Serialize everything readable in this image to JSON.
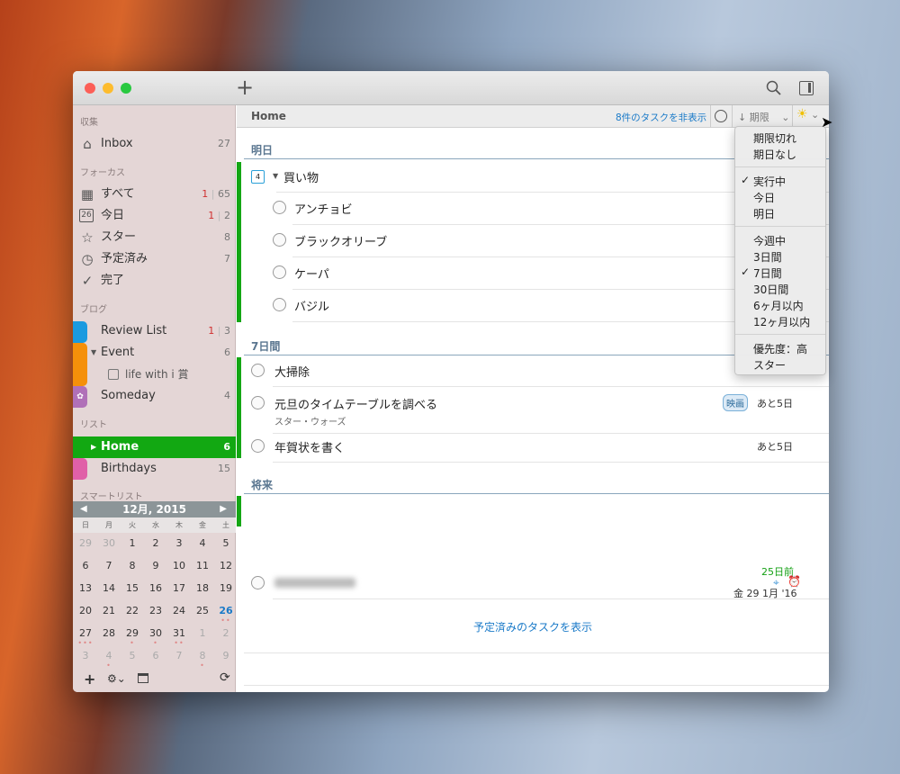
{
  "toolbar": {
    "add": "+",
    "search-icon": "search",
    "sidebar-toggle-icon": "sidebar"
  },
  "sidebar": {
    "sec_collect": "収集",
    "inbox": {
      "label": "Inbox",
      "count": "27"
    },
    "sec_focus": "フォーカス",
    "focus": [
      {
        "label": "すべて",
        "red": "1",
        "count": "65"
      },
      {
        "label": "今日",
        "red": "1",
        "count": "2"
      },
      {
        "label": "スター",
        "count": "8"
      },
      {
        "label": "予定済み",
        "count": "7"
      },
      {
        "label": "完了"
      }
    ],
    "today_icon_num": "26",
    "sec_blog": "ブログ",
    "blog": [
      {
        "label": "Review List",
        "red": "1",
        "count": "3",
        "color": "#1a9ae0"
      },
      {
        "label": "Event",
        "count": "6",
        "color": "#f5900a"
      },
      {
        "label": "life with i 賞"
      },
      {
        "label": "Someday",
        "count": "4",
        "color": "#b070b8"
      }
    ],
    "sec_list": "リスト",
    "lists": [
      {
        "label": "Home",
        "count": "6",
        "color": "#12a812"
      },
      {
        "label": "Birthdays",
        "count": "15",
        "color": "#e060a8"
      }
    ],
    "sec_smart": "スマートリスト",
    "sep": "|"
  },
  "calendar": {
    "month": "12月, 2015",
    "weekdays": [
      "日",
      "月",
      "火",
      "水",
      "木",
      "金",
      "土"
    ],
    "weeks": [
      [
        "29",
        "30",
        "1",
        "2",
        "3",
        "4",
        "5"
      ],
      [
        "6",
        "7",
        "8",
        "9",
        "10",
        "11",
        "12"
      ],
      [
        "13",
        "14",
        "15",
        "16",
        "17",
        "18",
        "19"
      ],
      [
        "20",
        "21",
        "22",
        "23",
        "24",
        "25",
        "26"
      ],
      [
        "27",
        "28",
        "29",
        "30",
        "31",
        "1",
        "2"
      ],
      [
        "3",
        "4",
        "5",
        "6",
        "7",
        "8",
        "9"
      ]
    ],
    "today": "26"
  },
  "main": {
    "title": "Home",
    "hide_tasks": "8件のタスクを非表示",
    "sort_label": "期限",
    "show_scheduled": "予定済みのタスクを表示",
    "groups": [
      {
        "label": "明日"
      },
      {
        "label": "7日間"
      },
      {
        "label": "将来"
      }
    ],
    "project": {
      "label": "買い物",
      "icon_num": "4"
    },
    "subtasks": [
      "アンチョビ",
      "ブラックオリーブ",
      "ケーパ",
      "バジル"
    ],
    "tasks": [
      {
        "label": "大掃除"
      },
      {
        "label": "元旦のタイムテーブルを調べる",
        "note": "スター・ウォーズ",
        "tag": "映画",
        "due": "あと5日"
      },
      {
        "label": "年賀状を書く",
        "due": "あと5日"
      }
    ],
    "future": {
      "overdue": "25日前",
      "date": "金 29 1月 '16"
    }
  },
  "menu": {
    "items1": [
      "期限切れ",
      "期日なし"
    ],
    "items2": [
      "実行中",
      "今日",
      "明日"
    ],
    "items3": [
      "今週中",
      "3日間",
      "7日間",
      "30日間",
      "6ヶ月以内",
      "12ヶ月以内"
    ],
    "items4": [
      "優先度：高",
      "スター"
    ],
    "check": "✓"
  },
  "colors": {
    "accent": "#1a7ac8",
    "list_green": "#12a812",
    "overdue": "#d03030"
  }
}
